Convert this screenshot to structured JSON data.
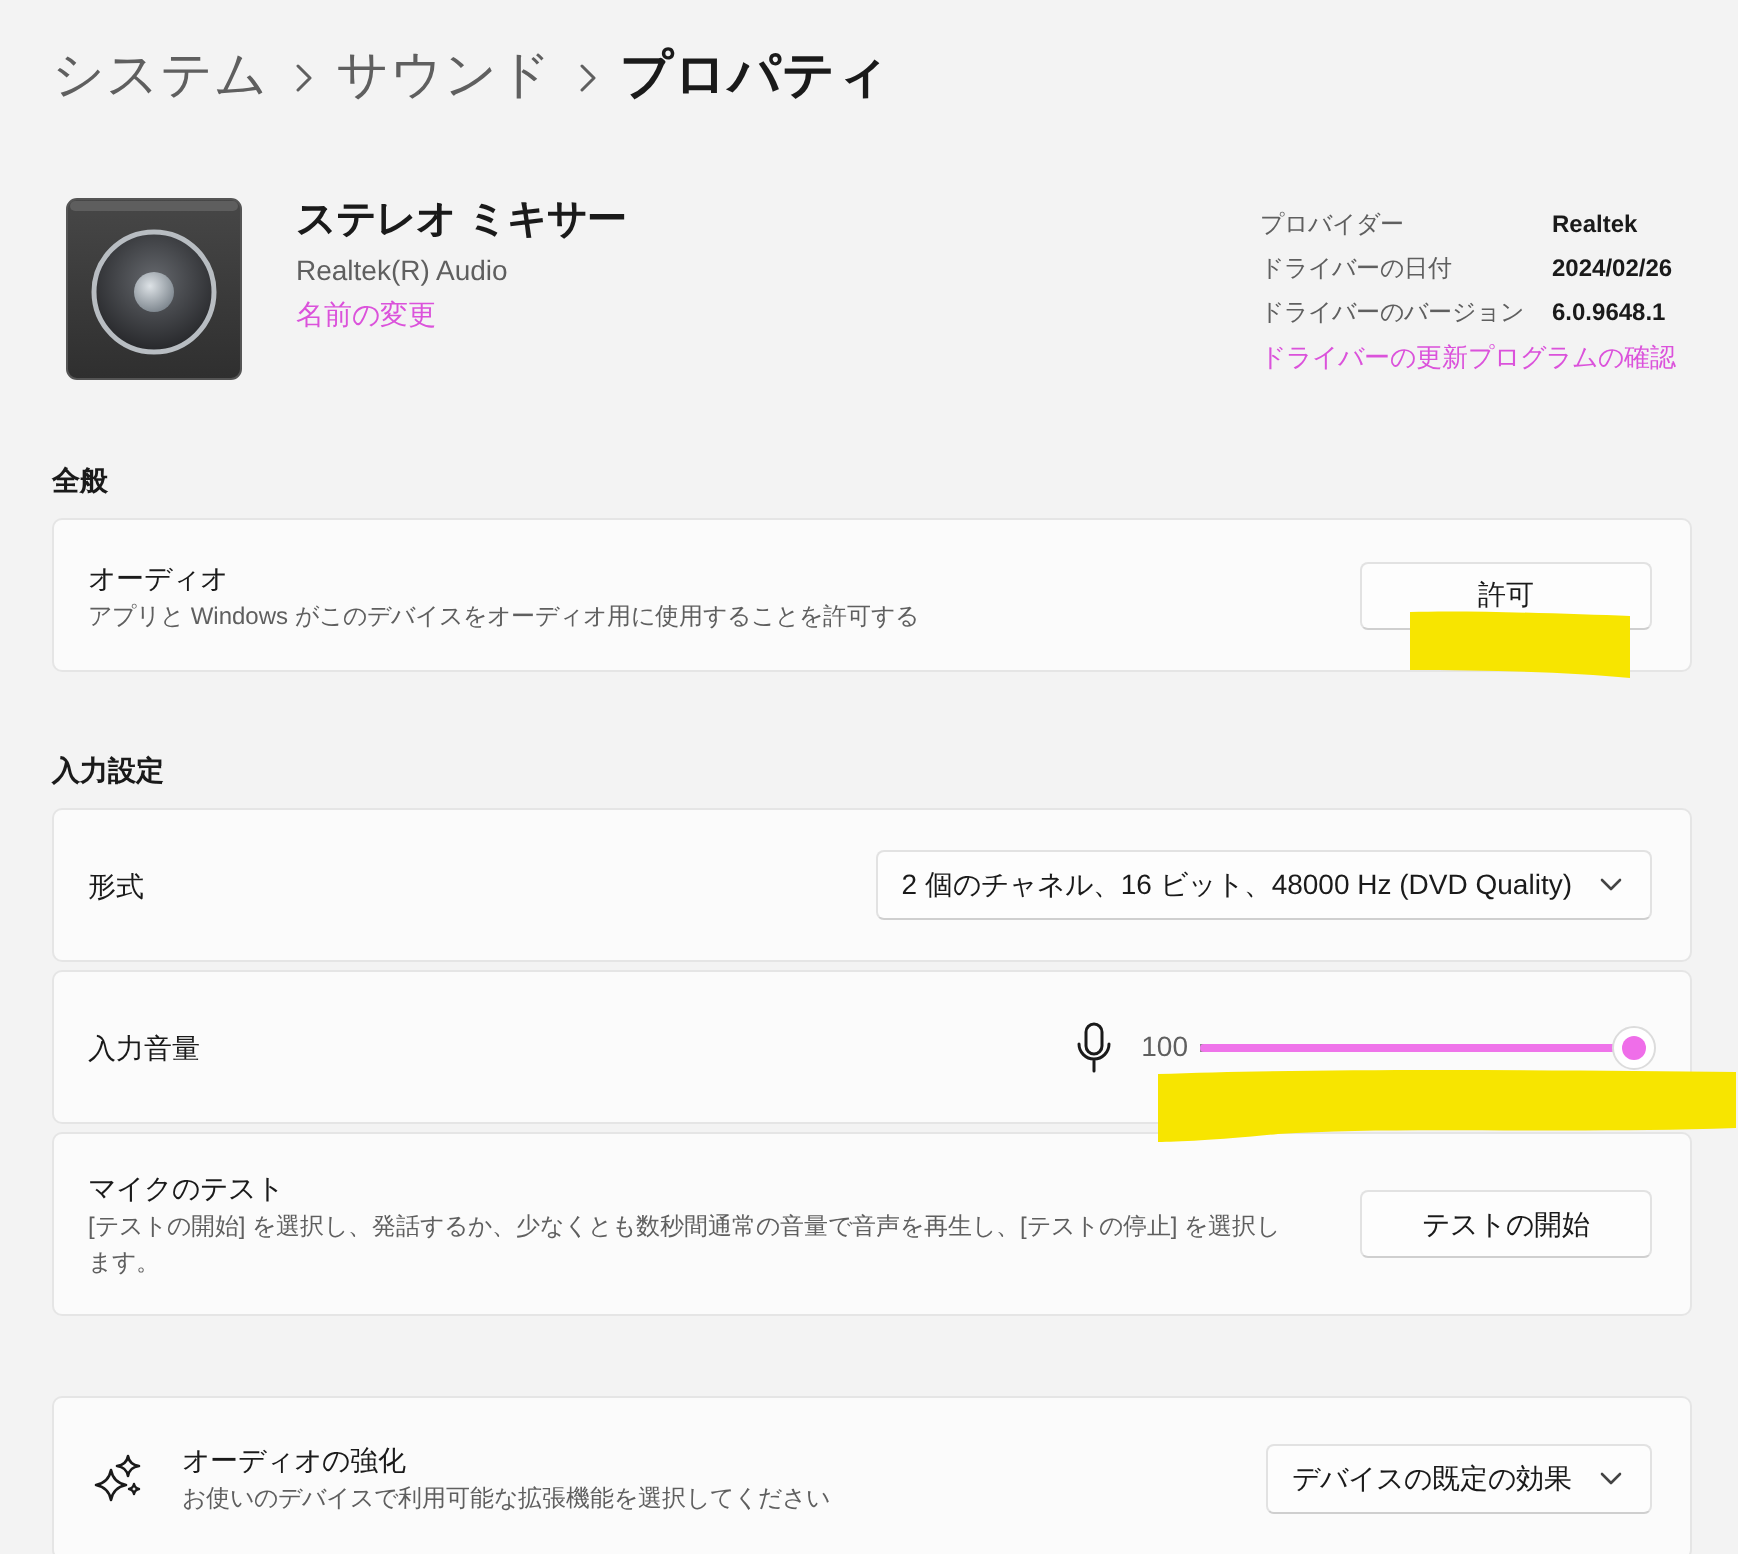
{
  "breadcrumb": [
    {
      "label": "システム",
      "current": false
    },
    {
      "label": "サウンド",
      "current": false
    },
    {
      "label": "プロパティ",
      "current": true
    }
  ],
  "device": {
    "name": "ステレオ ミキサー",
    "subtitle": "Realtek(R) Audio",
    "rename_link": "名前の変更"
  },
  "driver_info": {
    "rows": [
      {
        "label": "プロバイダー",
        "value": "Realtek"
      },
      {
        "label": "ドライバーの日付",
        "value": "2024/02/26"
      },
      {
        "label": "ドライバーのバージョン",
        "value": "6.0.9648.1"
      }
    ],
    "update_link": "ドライバーの更新プログラムの確認"
  },
  "sections": [
    {
      "title": "全般",
      "cards": [
        {
          "kind": "button",
          "with_icon": false,
          "title": "オーディオ",
          "description": "アプリと Windows がこのデバイスをオーディオ用に使用することを許可する",
          "button": "許可",
          "highlighted": true
        }
      ]
    },
    {
      "title": "入力設定",
      "cards": [
        {
          "kind": "dropdown",
          "with_icon": false,
          "title": "形式",
          "value": "2 個のチャネル、16 ビット、48000 Hz (DVD Quality)",
          "highlighted": false
        },
        {
          "kind": "slider",
          "with_icon": false,
          "title": "入力音量",
          "reading": "100",
          "level": 1.0,
          "highlighted": true
        },
        {
          "kind": "button",
          "with_icon": false,
          "title": "マイクのテスト",
          "description": "[テストの開始] を選択し、発話するか、少なくとも数秒間通常の音量で音声を再生し、[テストの停止] を選択します。",
          "button": "テストの開始",
          "highlighted": false
        }
      ]
    },
    {
      "cards": [
        {
          "kind": "dropdown",
          "with_icon": true,
          "title": "オーディオの強化",
          "description": "お使いのデバイスで利用可能な拡張機能を選択してください",
          "value": "デバイスの既定の効果",
          "highlighted": false
        }
      ]
    }
  ]
}
